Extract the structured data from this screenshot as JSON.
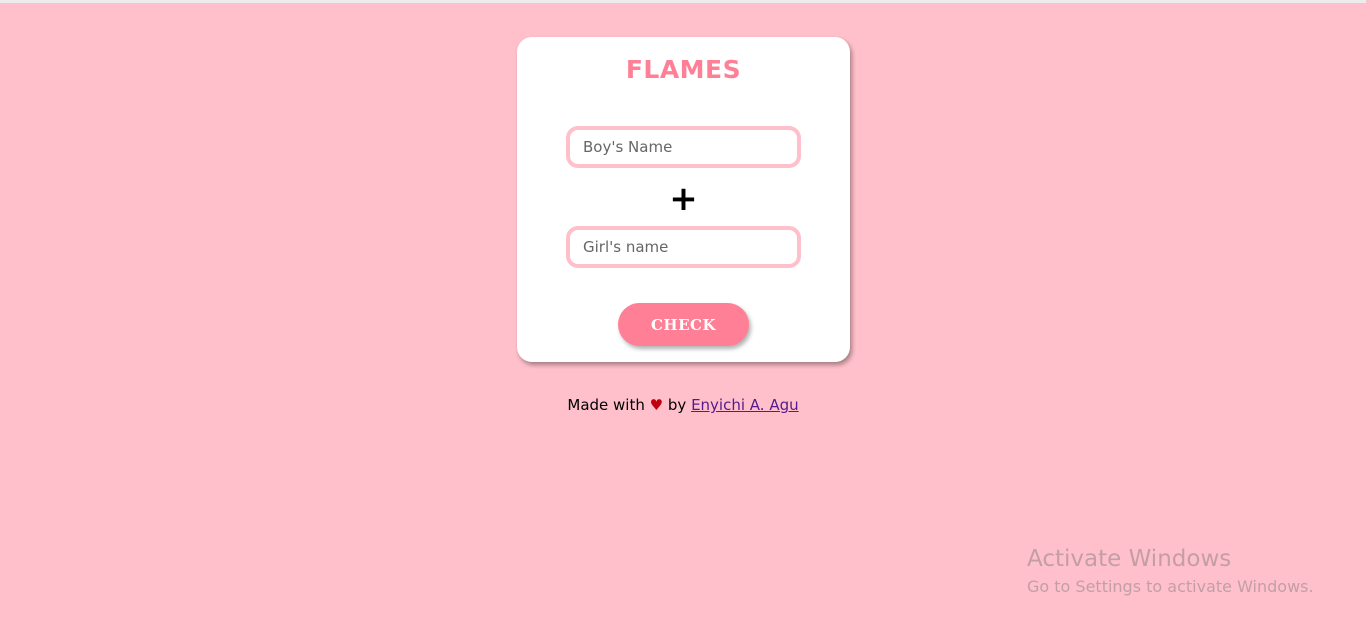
{
  "app": {
    "title": "FLAMES"
  },
  "form": {
    "boy_placeholder": "Boy's Name",
    "boy_value": "",
    "plus_symbol": "+",
    "girl_placeholder": "Girl's name",
    "girl_value": "",
    "check_label": "CHECK"
  },
  "footer": {
    "made_with": "Made with",
    "heart": "♥",
    "by": "by",
    "author_link": "Enyichi A. Agu"
  },
  "watermark": {
    "title": "Activate Windows",
    "subtitle": "Go to Settings to activate Windows."
  },
  "colors": {
    "background": "#ffc0cb",
    "accent": "#ff8096",
    "card": "#ffffff",
    "heart": "#c0000e",
    "link": "#551a8b"
  }
}
